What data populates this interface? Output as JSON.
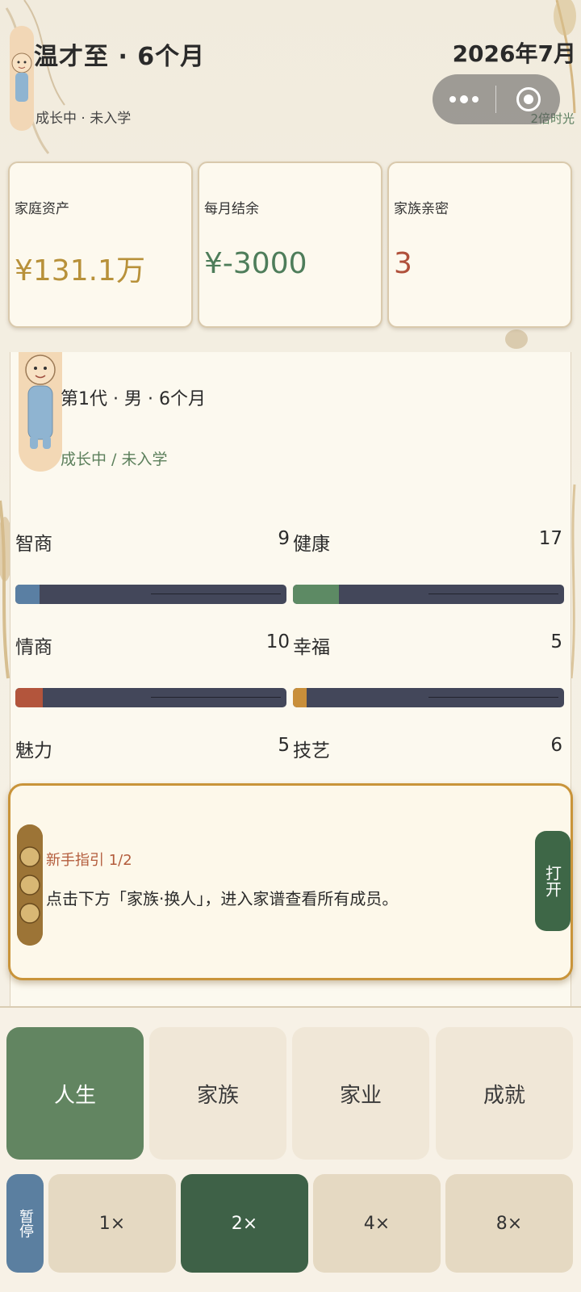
{
  "header": {
    "title": "温才至 · 6个月",
    "subtitle": "成长中 · 未入学",
    "date": "2026年7月",
    "time_label": "2倍时光"
  },
  "stats": [
    {
      "label": "家庭资产",
      "value": "¥131.1万",
      "color": "#b8913a"
    },
    {
      "label": "每月结余",
      "value": "¥-3000",
      "color": "#4e7d5a"
    },
    {
      "label": "家族亲密",
      "value": "3",
      "color": "#b0503a"
    }
  ],
  "character": {
    "generation_line": "第1代 · 男 · 6个月",
    "status_line": "成长中 / 未入学",
    "attributes": [
      {
        "label": "智商",
        "value": "9",
        "fill": 0.09,
        "color": "#5a7fa3"
      },
      {
        "label": "健康",
        "value": "17",
        "fill": 0.17,
        "color": "#5d8a64"
      },
      {
        "label": "情商",
        "value": "10",
        "fill": 0.1,
        "color": "#b3553c"
      },
      {
        "label": "幸福",
        "value": "5",
        "fill": 0.05,
        "color": "#c98f3a"
      },
      {
        "label": "魅力",
        "value": "5"
      },
      {
        "label": "技艺",
        "value": "6"
      }
    ]
  },
  "guide": {
    "title": "新手指引 1/2",
    "text": "点击下方「家族·换人」，进入家谱查看所有成员。",
    "button": "打开"
  },
  "nav": {
    "tabs": [
      "人生",
      "家族",
      "家业",
      "成就"
    ],
    "active_tab": "人生"
  },
  "speed": {
    "pause": "暂停",
    "options": [
      "1×",
      "2×",
      "4×",
      "8×"
    ],
    "active": "2×"
  },
  "colors": {
    "primary_green": "#628561",
    "dark_green": "#3e6147",
    "pause_blue": "#5b7fa0",
    "gold_border": "#c9943a"
  },
  "icons": {
    "menu": "more-dots-icon",
    "close": "target-circle-icon"
  }
}
